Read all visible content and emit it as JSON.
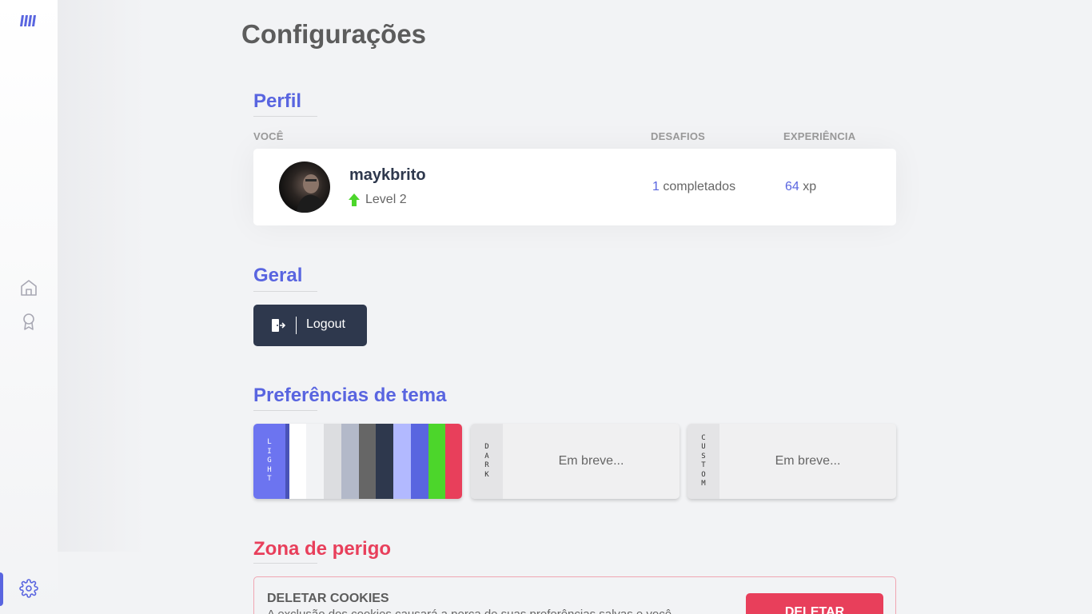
{
  "sidebar": {
    "logo_icon": "logo-icon",
    "items": [
      {
        "name": "home",
        "icon": "home-icon"
      },
      {
        "name": "award",
        "icon": "award-icon"
      },
      {
        "name": "settings",
        "icon": "gear-icon",
        "active": true
      }
    ],
    "accent": "#5965e0"
  },
  "page": {
    "title": "Configurações"
  },
  "profile": {
    "section_title": "Perfil",
    "headers": {
      "you": "VOCÊ",
      "challenges": "DESAFIOS",
      "experience": "EXPERIÊNCIA"
    },
    "username": "maykbrito",
    "level_label": "Level 2",
    "challenges_count": "1",
    "challenges_suffix": " completados",
    "xp_value": "64",
    "xp_suffix": " xp"
  },
  "general": {
    "section_title": "Geral",
    "logout_label": "Logout"
  },
  "themes": {
    "section_title": "Preferências de tema",
    "light": {
      "tag": "LIGHT",
      "tag_color": "#6c74f0",
      "swatches": [
        "#4953b8",
        "#ffffff",
        "#f2f3f5",
        "#dcdde0",
        "#b3b9c9",
        "#666666",
        "#2e384d",
        "#b2b9ff",
        "#5965e0",
        "#4cd62b",
        "#e83f5b"
      ]
    },
    "dark": {
      "tag": "DARK",
      "soon_label": "Em breve..."
    },
    "custom": {
      "tag": "CUSTOM",
      "soon_label": "Em breve..."
    }
  },
  "danger": {
    "section_title": "Zona de perigo",
    "item_title": "DELETAR COOKIES",
    "item_desc": "A exclusão dos cookies causará a perca de suas preferências salvas e você",
    "delete_label": "DELETAR",
    "color": "#e83f5b"
  }
}
